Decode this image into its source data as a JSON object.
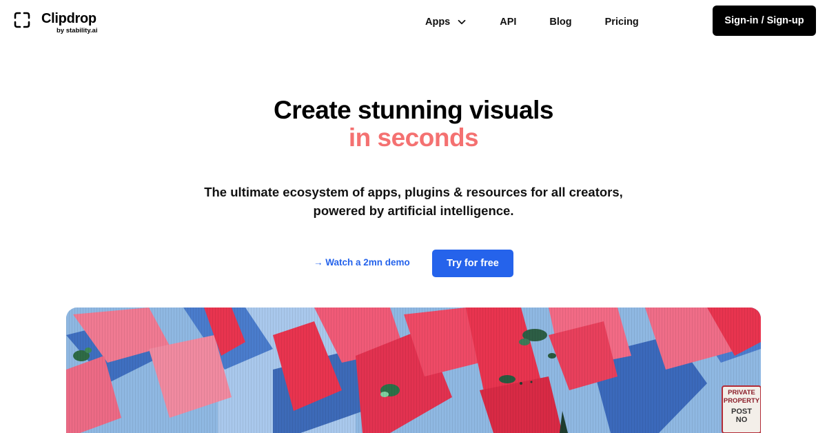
{
  "header": {
    "logo": {
      "name": "Clipdrop",
      "byline": "by stability.ai"
    },
    "nav": {
      "apps_label": "Apps",
      "api_label": "API",
      "blog_label": "Blog",
      "pricing_label": "Pricing"
    },
    "signin_label": "Sign-in / Sign-up"
  },
  "hero": {
    "title_line1": "Create stunning visuals",
    "title_line2": "in seconds",
    "subtitle_line1": "The ultimate ecosystem of apps, plugins & resources for all creators,",
    "subtitle_line2": "powered by artificial intelligence.",
    "demo_link_label": "→ Watch a 2mn demo",
    "try_button_label": "Try for free",
    "image": {
      "sign_lines": [
        "PRIVATE",
        "PROPERTY",
        "POST",
        "NO"
      ]
    }
  },
  "colors": {
    "accent_blue": "#2563eb",
    "accent_coral": "#f47171",
    "button_black": "#000000",
    "mural_sky": "#8fb8e2",
    "mural_red": "#e8344f"
  },
  "icons": {
    "logo": "clipdrop-corners-icon",
    "apps_dropdown": "chevron-down-icon"
  }
}
